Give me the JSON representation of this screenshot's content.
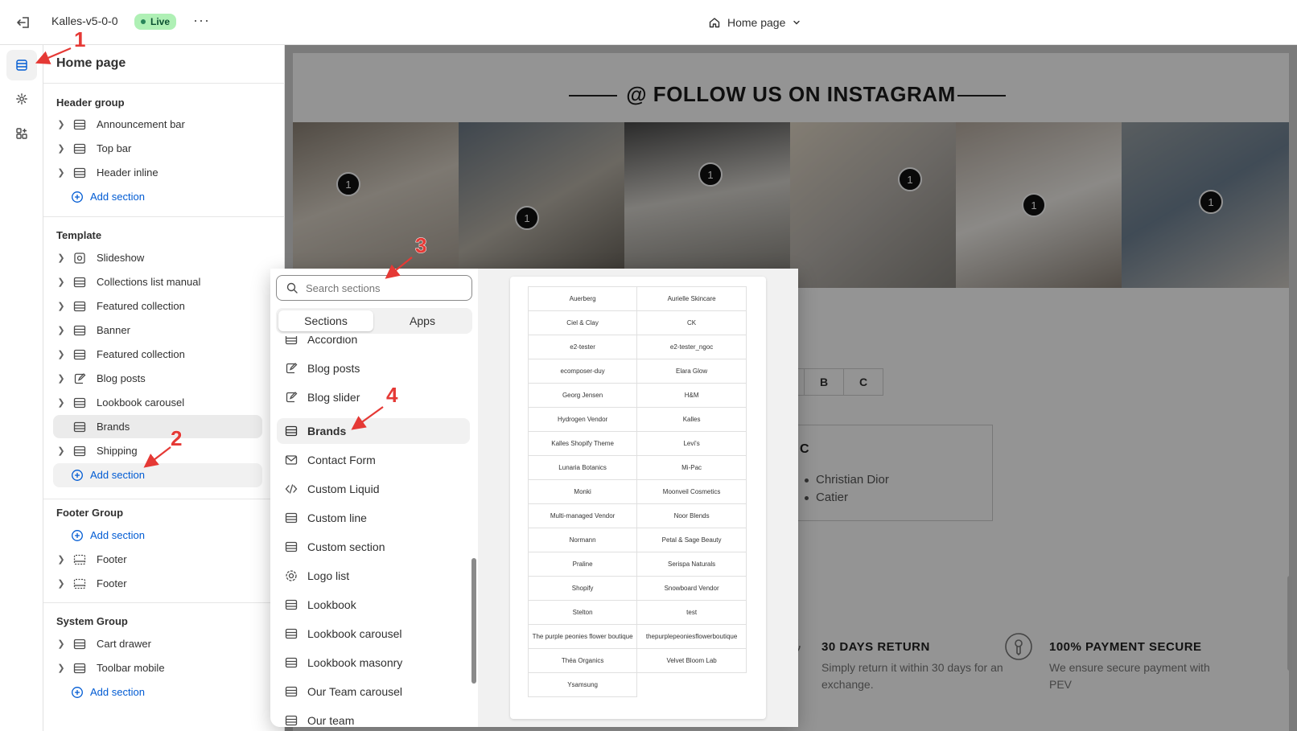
{
  "topbar": {
    "store_name": "Kalles-v5-0-0",
    "live_label": "Live",
    "more_label": "···",
    "page_label": "Home page"
  },
  "sidebar": {
    "title": "Home page",
    "groups": [
      {
        "title": "Header group",
        "items": [
          "Announcement bar",
          "Top bar",
          "Header inline"
        ],
        "add_label": "Add section"
      },
      {
        "title": "Template",
        "items": [
          "Slideshow",
          "Collections list manual",
          "Featured collection",
          "Banner",
          "Featured collection",
          "Blog posts",
          "Lookbook carousel",
          "Brands",
          "Shipping"
        ],
        "add_label": "Add section"
      },
      {
        "title": "Footer Group",
        "add_label": "Add section",
        "items": [
          "Footer",
          "Footer"
        ]
      },
      {
        "title": "System Group",
        "items": [
          "Cart drawer",
          "Toolbar mobile"
        ],
        "add_label": "Add section"
      }
    ]
  },
  "popover": {
    "search_placeholder": "Search sections",
    "tabs": [
      "Sections",
      "Apps"
    ],
    "active_tab": "Sections",
    "sections": [
      {
        "label": "Accordion",
        "icon": "section-icon"
      },
      {
        "label": "Blog posts",
        "icon": "blog-icon"
      },
      {
        "label": "Blog slider",
        "icon": "blog-icon"
      },
      {
        "label": "Brands",
        "icon": "section-icon"
      },
      {
        "label": "Contact Form",
        "icon": "email-icon"
      },
      {
        "label": "Custom Liquid",
        "icon": "code-icon"
      },
      {
        "label": "Custom line",
        "icon": "section-icon"
      },
      {
        "label": "Custom section",
        "icon": "section-icon"
      },
      {
        "label": "Logo list",
        "icon": "logo-icon"
      },
      {
        "label": "Lookbook",
        "icon": "section-icon"
      },
      {
        "label": "Lookbook carousel",
        "icon": "section-icon"
      },
      {
        "label": "Lookbook masonry",
        "icon": "section-icon"
      },
      {
        "label": "Our Team carousel",
        "icon": "section-icon"
      },
      {
        "label": "Our team",
        "icon": "section-icon"
      }
    ],
    "selected_section": "Brands",
    "brand_preview": [
      [
        "Auerberg",
        "Aurielle Skincare"
      ],
      [
        "Ciel & Clay",
        "CK"
      ],
      [
        "e2-tester",
        "e2-tester_ngoc"
      ],
      [
        "ecomposer-duy",
        "Elara Glow"
      ],
      [
        "Georg Jensen",
        "H&M"
      ],
      [
        "Hydrogen Vendor",
        "Kalles"
      ],
      [
        "Kalles Shopify Theme",
        "Levi's"
      ],
      [
        "Lunaria Botanics",
        "Mi-Pac"
      ],
      [
        "Monki",
        "Moonveil Cosmetics"
      ],
      [
        "Multi-managed Vendor",
        "Noor Blends"
      ],
      [
        "Normann",
        "Petal & Sage Beauty"
      ],
      [
        "Praline",
        "Serispa Naturals"
      ],
      [
        "Shopify",
        "Snowboard Vendor"
      ],
      [
        "Stelton",
        "test"
      ],
      [
        "The purple peonies flower boutique",
        "thepurplepeoniesflowerboutique"
      ],
      [
        "Théa Organics",
        "Velvet Bloom Lab"
      ],
      [
        "Ysamsung",
        ""
      ]
    ]
  },
  "preview": {
    "instagram_title": "@ FOLLOW US ON INSTAGRAM",
    "photo_badges": [
      "1",
      "1",
      "1",
      "1",
      "1",
      "1"
    ],
    "extra_badge": "2",
    "letter_tabs": [
      "B",
      "C"
    ],
    "vendor_letter": "C",
    "vendors": [
      "Christian Dior",
      "Catier"
    ],
    "features": [
      {
        "title": "30 DAYS RETURN",
        "desc": "Simply return it within 30 days for an exchange."
      },
      {
        "title": "100% PAYMENT SECURE",
        "desc": "We ensure secure payment with PEV"
      }
    ]
  },
  "callouts": [
    "1",
    "2",
    "3",
    "4"
  ],
  "colors": {
    "accent": "#005bd3",
    "live_badge": "#aff0b5",
    "callout": "#e53935"
  }
}
